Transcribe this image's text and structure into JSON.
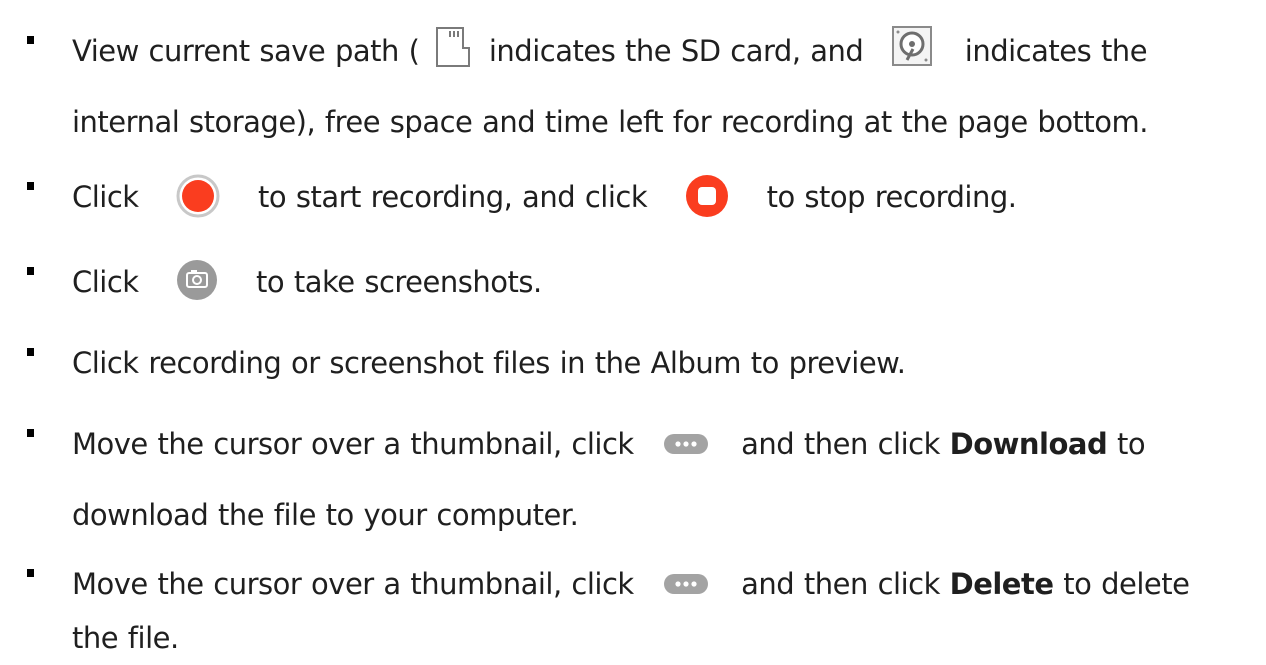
{
  "items": [
    {
      "line1": {
        "t1": "View current save path (",
        "t2": "indicates the SD card, and",
        "t3": "indicates the"
      },
      "line2": "internal storage), free space and time left for recording at the page bottom."
    },
    {
      "t1": "Click",
      "t2": "to start recording, and click",
      "t3": "to stop recording."
    },
    {
      "t1": "Click",
      "t2": "to take screenshots."
    },
    {
      "t1": "Click recording or screenshot files in the Album to preview."
    },
    {
      "line1": {
        "t1": "Move the cursor over a thumbnail, click",
        "t2": "and then click",
        "bold": "Download",
        "t3": "to"
      },
      "line2": "download the file to your computer."
    },
    {
      "line1": {
        "t1": "Move the cursor over a thumbnail, click",
        "t2": "and then click",
        "bold": "Delete",
        "t3": "to delete"
      },
      "line2": "the file."
    }
  ],
  "icons": {
    "sd_card": "sd-card-icon",
    "internal_storage": "internal-storage-icon",
    "record": "record-icon",
    "stop": "stop-icon",
    "camera": "camera-icon",
    "more": "more-icon"
  },
  "colors": {
    "text": "#1f1f1f",
    "record_red": "#fa3d1f",
    "icon_gray": "#8c8c8c",
    "button_gray": "#a0a0a0"
  }
}
